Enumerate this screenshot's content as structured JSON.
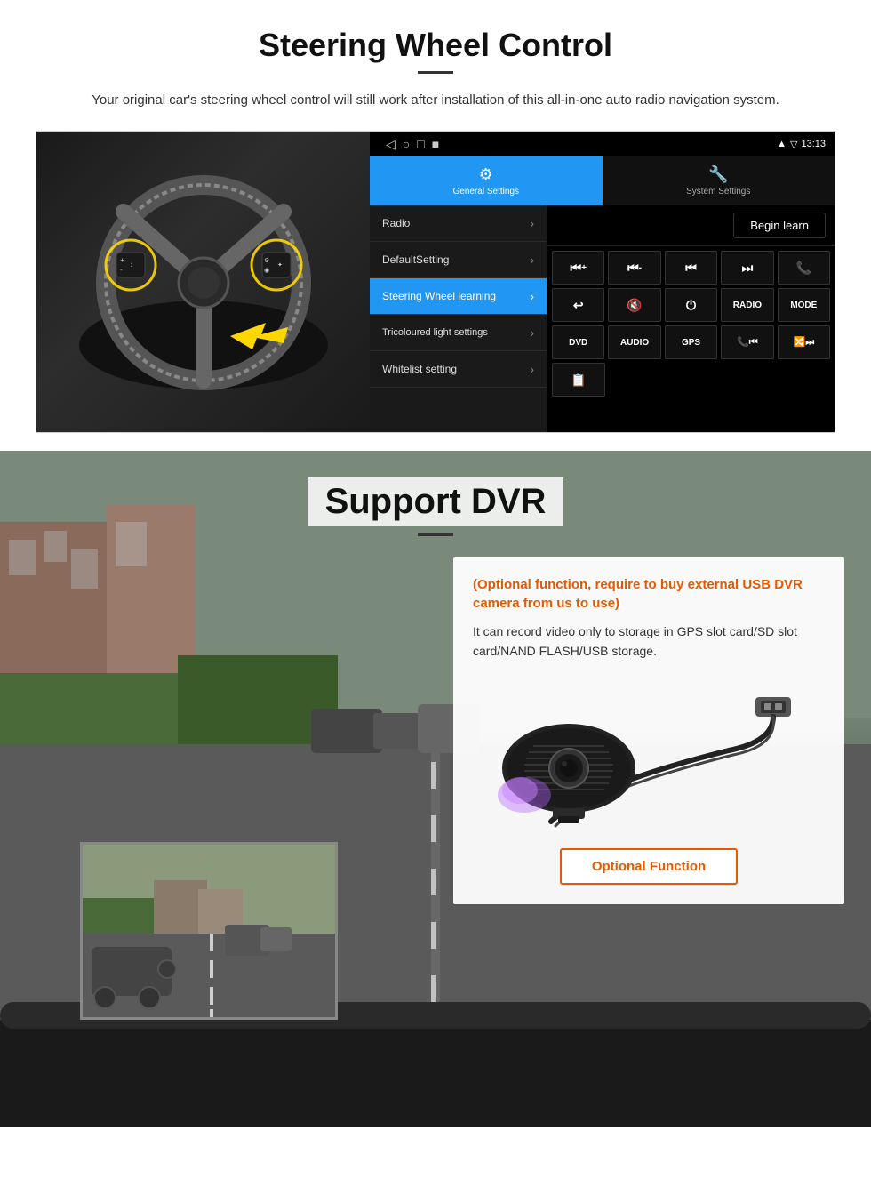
{
  "steering": {
    "title": "Steering Wheel Control",
    "subtitle": "Your original car's steering wheel control will still work after installation of this all-in-one auto radio navigation system.",
    "statusbar": {
      "time": "13:13",
      "nav_icons": [
        "◁",
        "○",
        "□",
        "■"
      ]
    },
    "tabs": {
      "active": {
        "label": "General Settings",
        "icon": "⚙"
      },
      "inactive": {
        "label": "System Settings",
        "icon": "🔧"
      }
    },
    "menu_items": [
      {
        "label": "Radio",
        "active": false
      },
      {
        "label": "DefaultSetting",
        "active": false
      },
      {
        "label": "Steering Wheel learning",
        "active": true
      },
      {
        "label": "Tricoloured light settings",
        "active": false
      },
      {
        "label": "Whitelist setting",
        "active": false
      }
    ],
    "begin_learn": "Begin learn",
    "controls": [
      [
        "⏮+",
        "⏮-",
        "⏮",
        "⏭",
        "📞"
      ],
      [
        "↩",
        "🔇×",
        "⏻",
        "RADIO",
        "MODE"
      ],
      [
        "DVD",
        "AUDIO",
        "GPS",
        "📞⏮",
        "🔀⏭"
      ],
      [
        "📄"
      ]
    ]
  },
  "dvr": {
    "title": "Support DVR",
    "optional_text": "(Optional function, require to buy external USB DVR camera from us to use)",
    "description": "It can record video only to storage in GPS slot card/SD slot card/NAND FLASH/USB storage.",
    "button_label": "Optional Function"
  }
}
